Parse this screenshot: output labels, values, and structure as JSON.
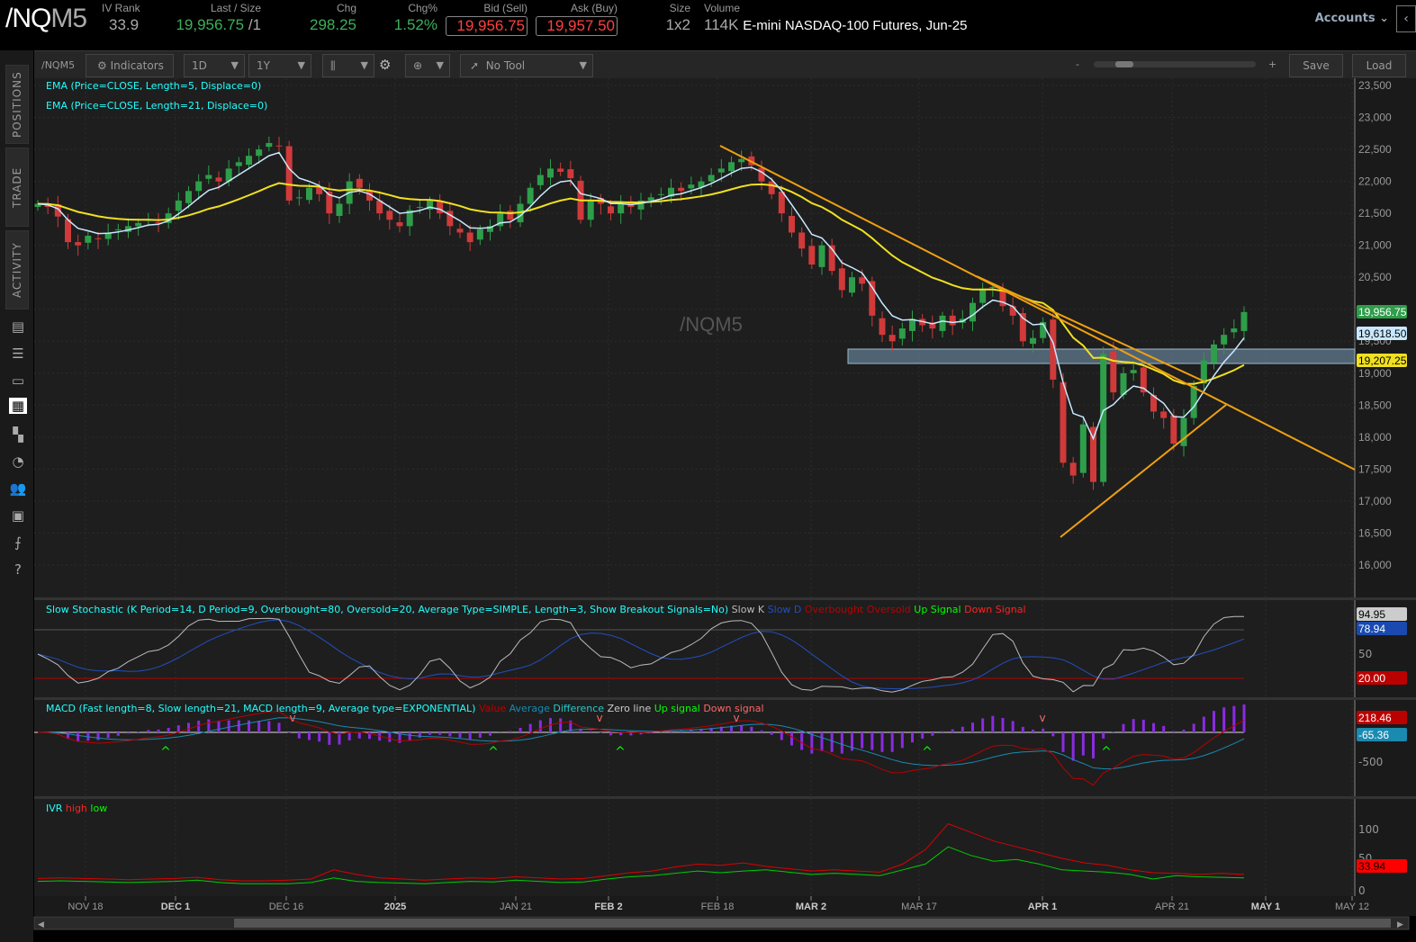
{
  "header": {
    "symbol_prefix": "/NQ",
    "symbol_suffix": "M5",
    "iv_rank_label": "IV Rank",
    "iv_rank": "33.9",
    "last_label": "Last / Size",
    "last": "19,956.75",
    "last_size": "/1",
    "chg_label": "Chg",
    "chg": "298.25",
    "chgpct_label": "Chg%",
    "chgpct": "1.52%",
    "bid_label": "Bid (Sell)",
    "bid": "19,956.75",
    "ask_label": "Ask (Buy)",
    "ask": "19,957.50",
    "size_label": "Size",
    "size": "1x2",
    "volume_label": "Volume",
    "volume": "114K",
    "description": "E-mini NASDAQ-100 Futures, Jun-25",
    "accounts": "Accounts"
  },
  "sidebar": {
    "tabs": [
      "POSITIONS",
      "TRADE",
      "ACTIVITY"
    ]
  },
  "toolbar": {
    "symbol": "/NQM5",
    "indicators": "Indicators",
    "aggregation": "1D",
    "range": "1Y",
    "tool": "No Tool",
    "zoom_minus": "-",
    "zoom_plus": "+",
    "save": "Save",
    "load": "Load"
  },
  "chart_data": {
    "type": "candlestick",
    "watermark": "/NQM5",
    "studies": {
      "ema5": "EMA (Price=CLOSE, Length=5, Displace=0)",
      "ema21": "EMA (Price=CLOSE, Length=21, Displace=0)"
    },
    "colors": {
      "up": "#2e9e4a",
      "down": "#d03a3a",
      "ema5": "#c8e8ff",
      "ema21": "#f0e020",
      "trend": "#f0a010"
    },
    "closes": [
      21650,
      21600,
      21450,
      21050,
      21000,
      21150,
      21100,
      21200,
      21250,
      21300,
      21350,
      21400,
      21350,
      21500,
      21700,
      21850,
      22000,
      22100,
      22000,
      22200,
      22300,
      22400,
      22500,
      22600,
      22550,
      21700,
      21750,
      21900,
      21800,
      21500,
      21650,
      22000,
      21900,
      21700,
      21500,
      21400,
      21300,
      21550,
      21600,
      21700,
      21500,
      21300,
      21200,
      21050,
      21250,
      21300,
      21500,
      21400,
      21650,
      21900,
      22100,
      22200,
      22150,
      22050,
      21400,
      21700,
      21650,
      21500,
      21650,
      21600,
      21700,
      21750,
      21800,
      21900,
      21850,
      21950,
      22000,
      22100,
      22200,
      22300,
      22350,
      22250,
      22000,
      21800,
      21500,
      21200,
      20950,
      20700,
      21000,
      20600,
      20300,
      20500,
      20400,
      19900,
      19600,
      19500,
      19700,
      19850,
      19750,
      19700,
      19900,
      19750,
      19850,
      20100,
      20300,
      20350,
      20050,
      19900,
      19500,
      19550,
      19800,
      18900,
      17600,
      17400,
      18200,
      17300,
      19300,
      18700,
      19000,
      19050,
      18700,
      18400,
      18300,
      17900,
      18300,
      18800,
      19200,
      19450,
      19600,
      19700,
      19956.75
    ],
    "yaxis_ticks": [
      "23,500",
      "23,000",
      "22,500",
      "22,000",
      "21,500",
      "21,000",
      "20,500",
      "20,000",
      "19,500",
      "19,000",
      "18,500",
      "18,000",
      "17,500",
      "17,000",
      "16,500",
      "16,000"
    ],
    "ylim": [
      16000,
      23500
    ],
    "price_tags": {
      "last": "19,956.75",
      "ema5": "19,618.50",
      "ema21": "19,207.25"
    },
    "xaxis_ticks": [
      {
        "label": "NOV 18",
        "bold": false
      },
      {
        "label": "DEC 1",
        "bold": true
      },
      {
        "label": "DEC 16",
        "bold": false
      },
      {
        "label": "2025",
        "bold": true
      },
      {
        "label": "JAN 21",
        "bold": false
      },
      {
        "label": "FEB 2",
        "bold": true
      },
      {
        "label": "FEB 18",
        "bold": false
      },
      {
        "label": "MAR 2",
        "bold": true
      },
      {
        "label": "MAR 17",
        "bold": false
      },
      {
        "label": "APR 1",
        "bold": true
      },
      {
        "label": "APR 21",
        "bold": false
      },
      {
        "label": "MAY 1",
        "bold": true
      },
      {
        "label": "MAY 12",
        "bold": false
      }
    ],
    "stochastic": {
      "title": "Slow Stochastic (K Period=14, D Period=9, Overbought=80, Oversold=20, Average Type=SIMPLE, Length=3, Show Breakout Signals=No)",
      "legend": [
        "Slow K",
        "Slow D",
        "Overbought",
        "Oversold",
        "Up Signal",
        "Down Signal"
      ],
      "ticks": [
        "50"
      ],
      "tags": {
        "k": "94.95",
        "d": "78.94",
        "oversold": "20.00"
      }
    },
    "macd": {
      "title": "MACD (Fast length=8, Slow length=21, MACD length=9, Average type=EXPONENTIAL)",
      "legend": [
        "Value",
        "Average",
        "Difference",
        "Zero line",
        "Up signal",
        "Down signal"
      ],
      "ticks": [
        "-500"
      ],
      "tags": {
        "value": "218.46",
        "avg": "-65.36"
      }
    },
    "ivr": {
      "title": "IVR",
      "legend": [
        "high",
        "low"
      ],
      "ticks": [
        "100",
        "50",
        "0"
      ],
      "tag": "33.94",
      "low": [
        10,
        11,
        10,
        9,
        8,
        9,
        10,
        12,
        8,
        6,
        6,
        6,
        8,
        16,
        10,
        8,
        7,
        6,
        8,
        10,
        9,
        12,
        10,
        8,
        9,
        14,
        18,
        20,
        24,
        28,
        25,
        28,
        30,
        26,
        22,
        24,
        22,
        20,
        30,
        40,
        70,
        55,
        45,
        48,
        40,
        30,
        28,
        26,
        22,
        14,
        20,
        18,
        17,
        16
      ],
      "high": [
        15,
        16,
        15,
        14,
        13,
        14,
        15,
        17,
        13,
        11,
        11,
        12,
        14,
        30,
        22,
        16,
        14,
        12,
        14,
        16,
        15,
        18,
        16,
        14,
        15,
        20,
        25,
        28,
        35,
        40,
        38,
        42,
        36,
        32,
        28,
        30,
        28,
        26,
        40,
        65,
        110,
        95,
        80,
        70,
        60,
        50,
        42,
        38,
        30,
        25,
        24,
        22,
        24,
        22
      ]
    }
  }
}
